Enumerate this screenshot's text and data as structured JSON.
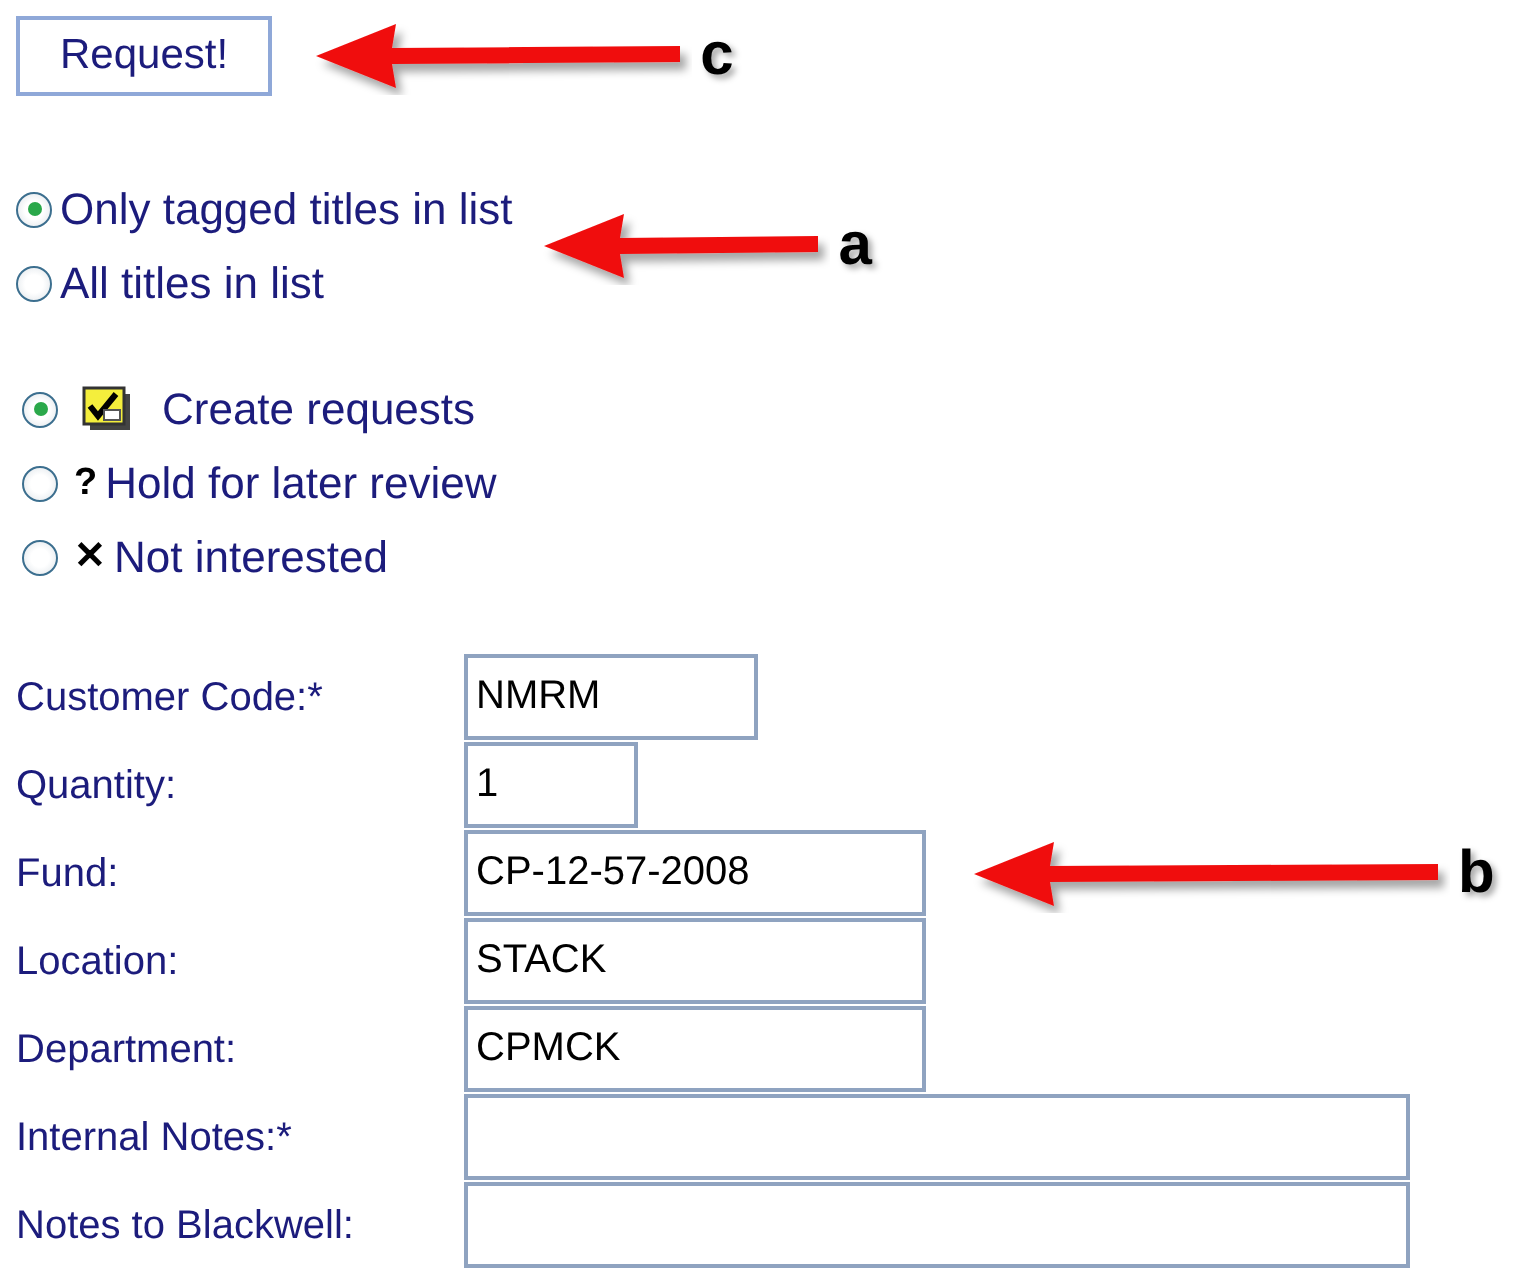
{
  "request_button": {
    "label": "Request!",
    "callout": "c"
  },
  "scope_options": [
    {
      "label": "Only tagged titles in list",
      "selected": true
    },
    {
      "label": "All titles in list",
      "selected": false
    }
  ],
  "scope_callout": "a",
  "action_options": [
    {
      "kind": "tick-image",
      "label": "Create requests",
      "selected": true
    },
    {
      "kind": "glyph",
      "glyph": "?",
      "label": "Hold for later review",
      "selected": false
    },
    {
      "kind": "glyph",
      "glyph": "✕",
      "label": "Not interested",
      "selected": false
    }
  ],
  "fields": [
    {
      "label": "Customer Code:*",
      "value": "NMRM"
    },
    {
      "label": "Quantity:",
      "value": "1"
    },
    {
      "label": "Fund:",
      "value": "CP-12-57-2008",
      "callout": "b"
    },
    {
      "label": "Location:",
      "value": "STACK"
    },
    {
      "label": "Department:",
      "value": "CPMCK"
    },
    {
      "label": "Internal Notes:*"
    },
    {
      "label": "Notes to Blackwell:"
    }
  ]
}
